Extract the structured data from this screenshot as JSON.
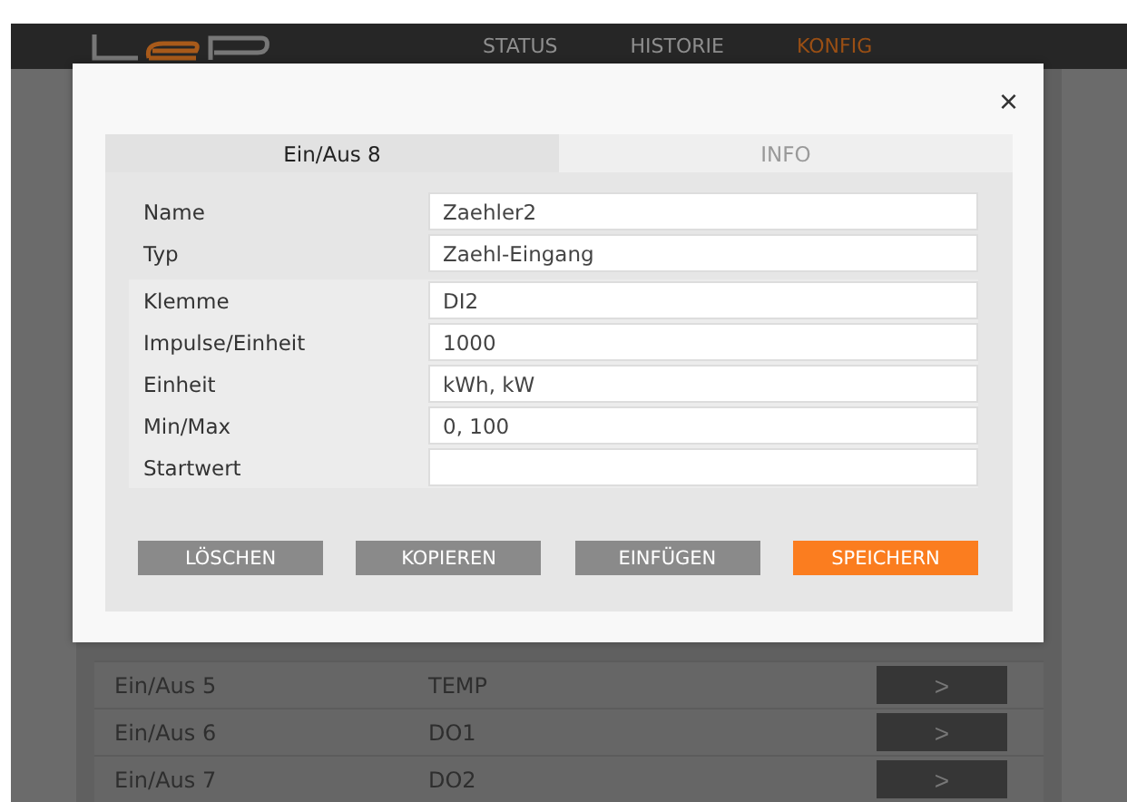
{
  "header": {
    "nav": [
      {
        "label": "STATUS",
        "selected": false
      },
      {
        "label": "HISTORIE",
        "selected": false
      },
      {
        "label": "KONFIG",
        "selected": true
      }
    ]
  },
  "list": {
    "rows": [
      {
        "name": "Ein/Aus 5",
        "type": "TEMP",
        "action": ">"
      },
      {
        "name": "Ein/Aus 6",
        "type": "DO1",
        "action": ">"
      },
      {
        "name": "Ein/Aus 7",
        "type": "DO2",
        "action": ">"
      }
    ]
  },
  "dialog": {
    "close": "×",
    "tabs": [
      {
        "label": "Ein/Aus 8",
        "selected": true
      },
      {
        "label": "INFO",
        "selected": false
      }
    ],
    "fields": [
      {
        "label": "Name",
        "value": "Zaehler2",
        "kind": "plain"
      },
      {
        "label": "Typ",
        "value": "Zaehl-Eingang",
        "kind": "plain"
      },
      {
        "label": "Klemme",
        "value": "DI2",
        "kind": "shaded"
      },
      {
        "label": "Impulse/Einheit",
        "value": "1000",
        "kind": "shaded"
      },
      {
        "label": "Einheit",
        "value": "kWh, kW",
        "kind": "shaded"
      },
      {
        "label": "Min/Max",
        "value": "0, 100",
        "kind": "shaded"
      },
      {
        "label": "Startwert",
        "kind": "shaded"
      }
    ],
    "buttons": [
      {
        "label": "LÖSCHEN",
        "primary": false
      },
      {
        "label": "KOPIEREN",
        "primary": false
      },
      {
        "label": "EINFÜGEN",
        "primary": false
      },
      {
        "label": "SPEICHERN",
        "primary": true
      }
    ]
  }
}
